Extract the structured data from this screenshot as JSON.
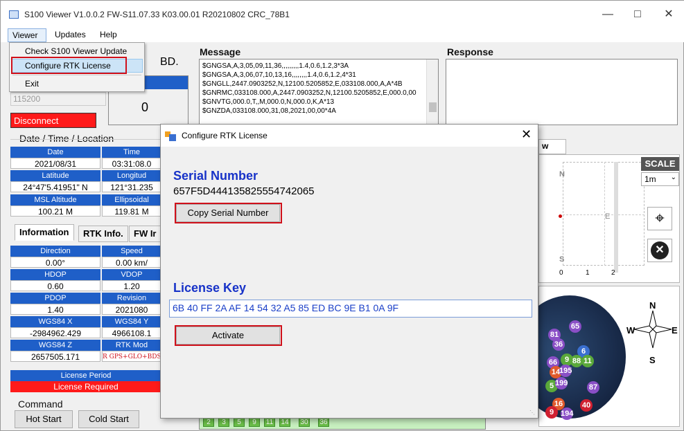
{
  "window": {
    "title": "S100 Viewer V1.0.0.2  FW-S11.07.33 K03.00.01 R20210802 CRC_78B1"
  },
  "menu": {
    "viewer": "Viewer",
    "updates": "Updates",
    "help": "Help"
  },
  "dropdown": {
    "check_update": "Check S100 Viewer Update",
    "configure_rtk": "Configure RTK License",
    "exit": "Exit"
  },
  "left": {
    "baud": "115200",
    "disconnect": "Disconnect",
    "bd_label": "BD.",
    "count": "0",
    "dtl_title": "Date / Time / Location",
    "date_h": "Date",
    "time_h": "Time",
    "date_v": "2021/08/31",
    "time_v": "03:31:08.0",
    "lat_h": "Latitude",
    "lon_h": "Longitud",
    "lat_v": "24°47'5.41951\" N",
    "lon_v": "121°31.235",
    "msl_h": "MSL Altitude",
    "ell_h": "Ellipsoidal",
    "msl_v": "100.21 M",
    "ell_v": "119.81 M"
  },
  "tabs": {
    "info": "Information",
    "rtk": "RTK Info.",
    "fw": "FW Ir"
  },
  "info": {
    "dir_h": "Direction",
    "spd_h": "Speed",
    "dir_v": "0.00°",
    "spd_v": "0.00 km/",
    "hdop_h": "HDOP",
    "vdop_h": "VDOP",
    "hdop_v": "0.60",
    "vdop_v": "1.20",
    "pdop_h": "PDOP",
    "rev_h": "Revision",
    "pdop_v": "1.40",
    "rev_v": "2021080",
    "wx_h": "WGS84 X",
    "wy_h": "WGS84 Y",
    "wx_v": "-2984962.429",
    "wy_v": "4966108.1",
    "wz_h": "WGS84 Z",
    "rtkmode_h": "RTK Mod",
    "wz_v": "2657505.171",
    "rtkmode_v": "R GPS+GLO+BDS",
    "lp_h": "License Period",
    "lp_v": "License Required"
  },
  "command": {
    "title": "Command",
    "hot": "Hot Start",
    "cold": "Cold Start"
  },
  "message": {
    "title": "Message",
    "lines": [
      "$GNGSA,A,3,05,09,11,36,,,,,,,,,1.4,0.6,1.2,3*3A",
      "$GNGSA,A,3,06,07,10,13,16,,,,,,,,1.4,0.6,1.2,4*31",
      "$GNGLL,2447.0903252,N,12100.5205852,E,033108.000,A,A*4B",
      "$GNRMC,033108.000,A,2447.0903252,N,12100.5205852,E,000.0,00",
      "$GNVTG,000.0,T,,M,000.0,N,000.0,K,A*13",
      "$GNZDA,033108.000,31,08,2021,00,00*4A"
    ]
  },
  "response": {
    "title": "Response"
  },
  "right": {
    "view_tab": "w",
    "scale_label": "SCALE",
    "scale_value": "1m",
    "n": "N",
    "e": "E",
    "s": "S",
    "ticks": [
      "0",
      "1",
      "2"
    ],
    "sky_n": "N",
    "sky_w": "W",
    "sky_e": "E",
    "sky_s": "S"
  },
  "sats": [
    "65",
    "81",
    "36",
    "6",
    "66",
    "9",
    "88",
    "11",
    "14",
    "195",
    "5",
    "199",
    "87",
    "16",
    "40",
    "9",
    "194"
  ],
  "green_sats": [
    "2",
    "3",
    "5",
    "9",
    "11",
    "14",
    "30",
    "36"
  ],
  "dialog": {
    "title": "Configure RTK License",
    "serial_head": "Serial Number",
    "serial_value": "657F5D444135825554742065",
    "copy_btn": "Copy Serial Number",
    "key_head": "License Key",
    "key_value": "6B 40 FF 2A AF 14 54 32 A5 85 ED BC 9E B1 0A 9F",
    "activate_btn": "Activate"
  },
  "colors": {
    "accent_blue": "#1f5fc8",
    "red": "#ff1a1a",
    "highlight": "#d0101a"
  }
}
